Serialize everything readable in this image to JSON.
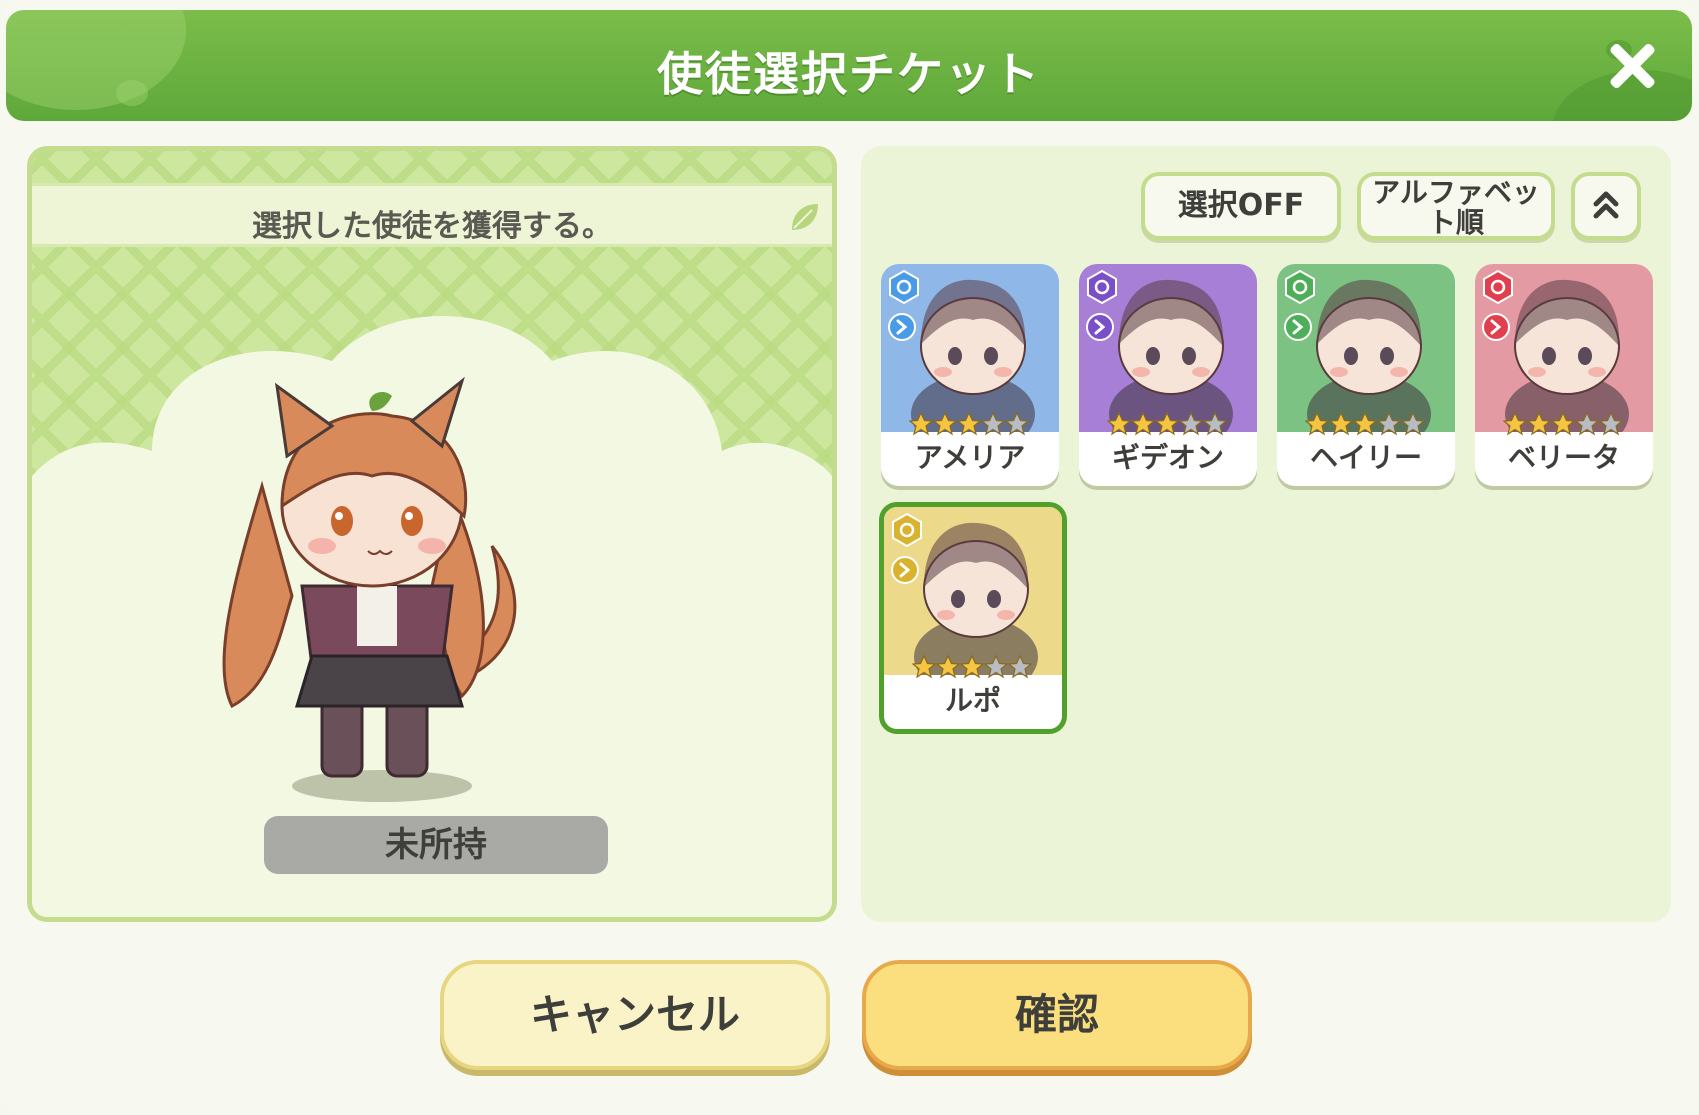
{
  "header": {
    "title": "使徒選択チケット",
    "close_icon": "close-icon"
  },
  "left_panel": {
    "banner_text": "選択した使徒を獲得する。",
    "status_label": "未所持",
    "preview_character": "ルポ"
  },
  "sort_controls": {
    "select_off_label": "選択OFF",
    "alphabet_sort_label_line1": "アルファベッ",
    "alphabet_sort_label_line2": "ト順",
    "collapse_icon": "double-chevron-up-icon"
  },
  "characters": [
    {
      "name": "アメリア",
      "stars": 3,
      "max_stars": 5,
      "element": "ice",
      "bg": "#8fb7e8",
      "selected": false
    },
    {
      "name": "ギデオン",
      "stars": 3,
      "max_stars": 5,
      "element": "dark",
      "bg": "#a77fd6",
      "selected": false
    },
    {
      "name": "ヘイリー",
      "stars": 3,
      "max_stars": 5,
      "element": "nature",
      "bg": "#7cc383",
      "selected": false
    },
    {
      "name": "ベリータ",
      "stars": 3,
      "max_stars": 5,
      "element": "fire",
      "bg": "#e49aa2",
      "selected": false
    },
    {
      "name": "ルポ",
      "stars": 3,
      "max_stars": 5,
      "element": "light",
      "bg": "#ecd98a",
      "selected": true
    }
  ],
  "buttons": {
    "cancel_label": "キャンセル",
    "confirm_label": "確認"
  },
  "colors": {
    "header_green": "#66ad3e",
    "selected_border": "#4fa12b",
    "confirm_yellow": "#fbde7e",
    "cancel_cream": "#fbf3c8"
  }
}
